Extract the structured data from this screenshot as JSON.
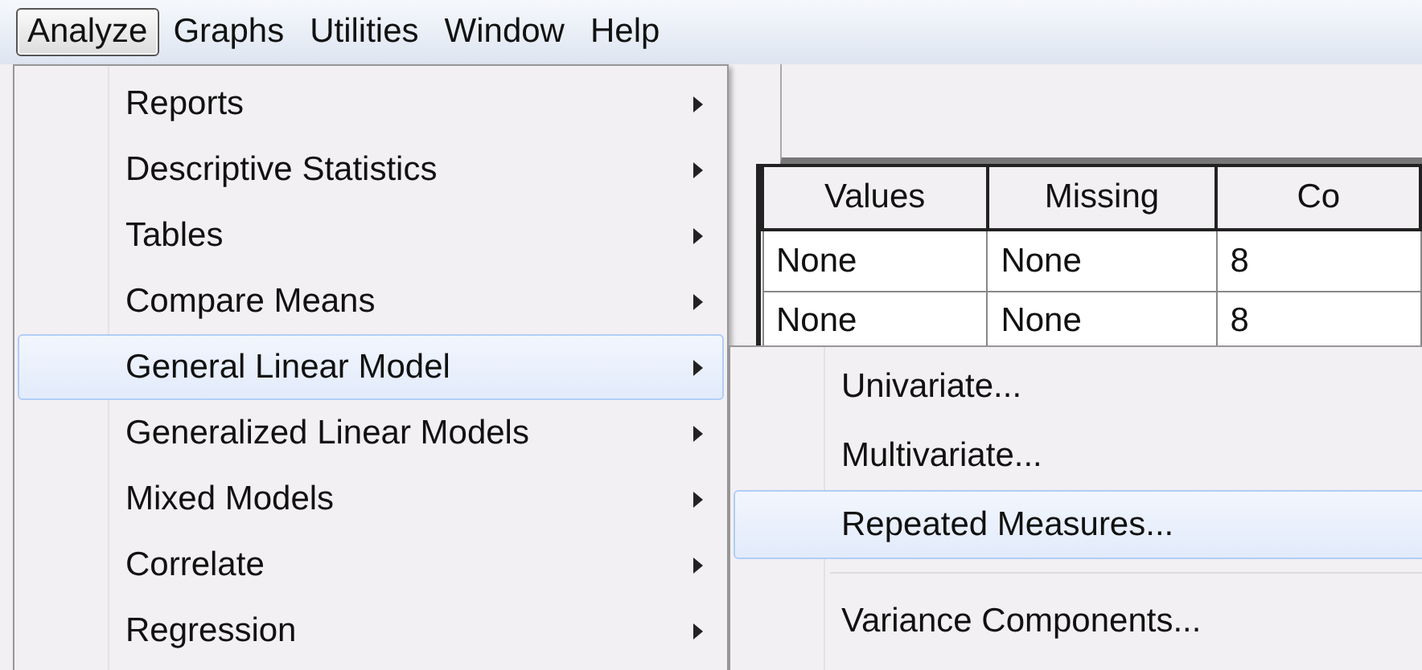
{
  "menu_bar": [
    {
      "label": "Analyze",
      "selected": true
    },
    {
      "label": "Graphs",
      "selected": false
    },
    {
      "label": "Utilities",
      "selected": false
    },
    {
      "label": "Window",
      "selected": false
    },
    {
      "label": "Help",
      "selected": false
    }
  ],
  "data_table": {
    "columns": [
      "Values",
      "Missing",
      "Co"
    ],
    "rows": [
      [
        "None",
        "None",
        "8"
      ],
      [
        "None",
        "None",
        "8"
      ]
    ]
  },
  "analyze_menu": {
    "items": [
      {
        "label": "Reports",
        "has_submenu": true,
        "selected": false
      },
      {
        "label": "Descriptive Statistics",
        "has_submenu": true,
        "selected": false
      },
      {
        "label": "Tables",
        "has_submenu": true,
        "selected": false
      },
      {
        "label": "Compare Means",
        "has_submenu": true,
        "selected": false
      },
      {
        "label": "General Linear Model",
        "has_submenu": true,
        "selected": true
      },
      {
        "label": "Generalized Linear Models",
        "has_submenu": true,
        "selected": false
      },
      {
        "label": "Mixed Models",
        "has_submenu": true,
        "selected": false
      },
      {
        "label": "Correlate",
        "has_submenu": true,
        "selected": false
      },
      {
        "label": "Regression",
        "has_submenu": true,
        "selected": false
      }
    ]
  },
  "submenu": {
    "items": [
      {
        "kind": "item",
        "label": "Univariate...",
        "selected": false
      },
      {
        "kind": "item",
        "label": "Multivariate...",
        "selected": false
      },
      {
        "kind": "item",
        "label": "Repeated Measures...",
        "selected": true
      },
      {
        "kind": "separator"
      },
      {
        "kind": "item",
        "label": "Variance Components...",
        "selected": false
      }
    ]
  }
}
